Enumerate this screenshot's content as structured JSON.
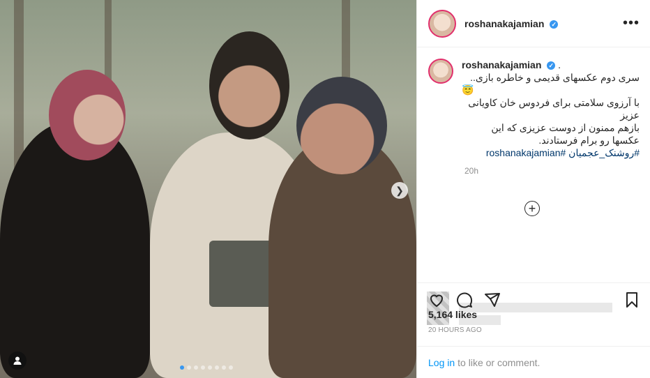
{
  "post": {
    "username": "roshanakajamian",
    "verified_mark": "✓",
    "more_icon": "•••",
    "caption_dot": ".",
    "caption_lines": [
      "سری دوم عکسهای قدیمی و خاطره بازی..",
      "😇",
      "با آرزوی سلامتی برای فردوس خان کاویانی عزیز",
      "بازهم ممنون از دوست عزیزی که این عکسها رو برام فرستادند."
    ],
    "hashtags": "#روشنک_عجمیان #roshanakajamian",
    "caption_time": "20h",
    "likes": "5,164 likes",
    "time_ago": "20 HOURS AGO",
    "login_link": "Log in",
    "login_suffix": "to like or comment."
  },
  "carousel": {
    "total_dots": 8,
    "active_index": 0
  },
  "icons": [
    "heart-icon",
    "comment-icon",
    "share-icon",
    "bookmark-icon",
    "plus-circle-icon",
    "chevron-right-icon",
    "user-tag-icon"
  ],
  "colors": {
    "link": "#0095f6",
    "hashtag": "#00376b",
    "verified": "#3897f0",
    "muted": "#8e8e8e"
  }
}
